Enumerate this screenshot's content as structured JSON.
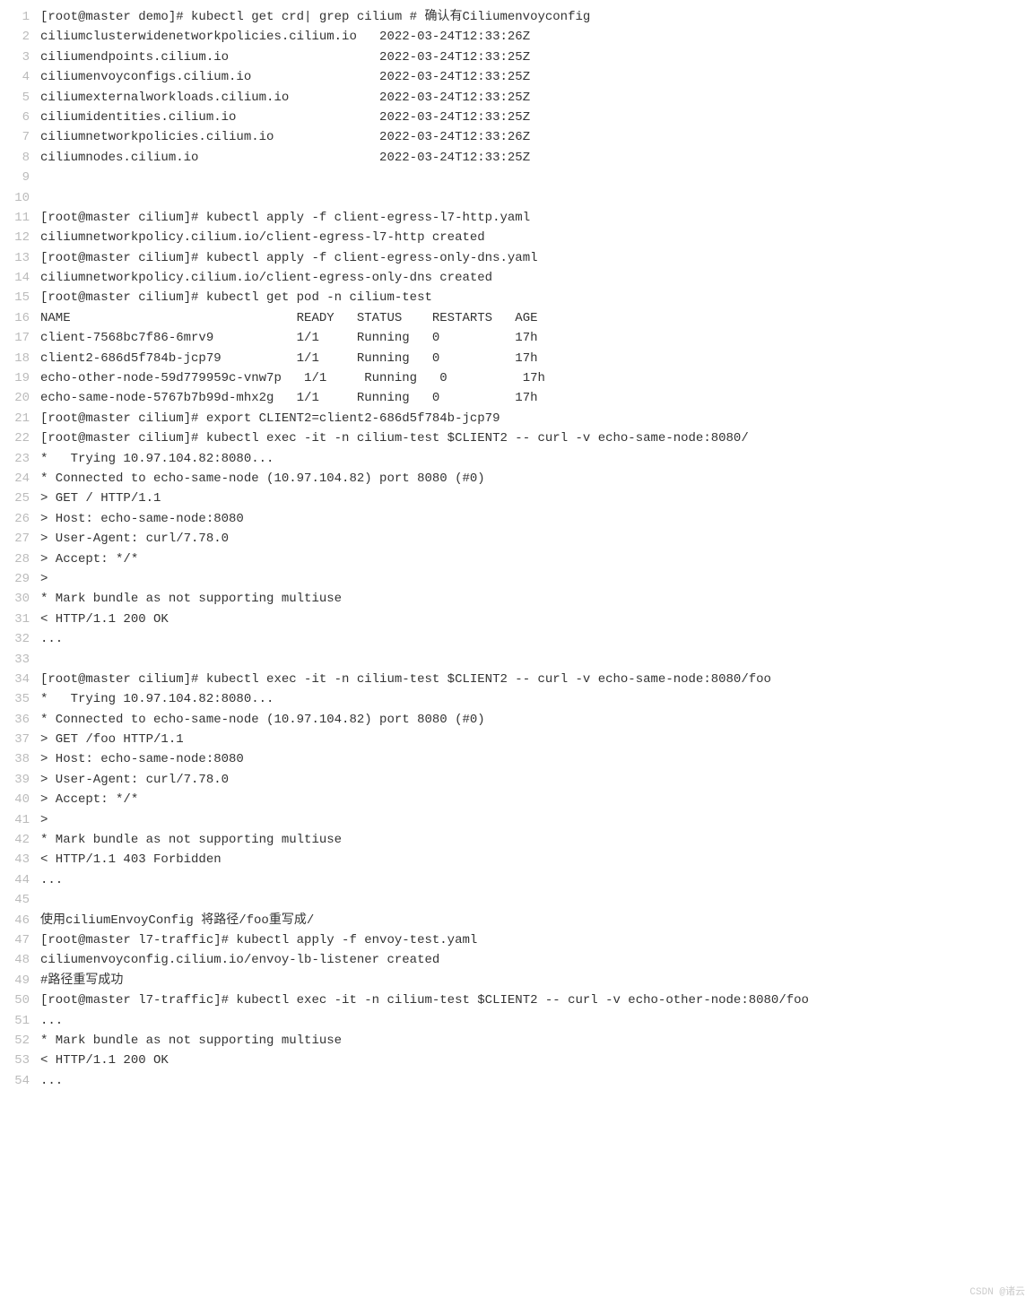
{
  "lines": [
    "[root@master demo]# kubectl get crd| grep cilium # 确认有Ciliumenvoyconfig",
    "ciliumclusterwidenetworkpolicies.cilium.io   2022-03-24T12:33:26Z",
    "ciliumendpoints.cilium.io                    2022-03-24T12:33:25Z",
    "ciliumenvoyconfigs.cilium.io                 2022-03-24T12:33:25Z",
    "ciliumexternalworkloads.cilium.io            2022-03-24T12:33:25Z",
    "ciliumidentities.cilium.io                   2022-03-24T12:33:25Z",
    "ciliumnetworkpolicies.cilium.io              2022-03-24T12:33:26Z",
    "ciliumnodes.cilium.io                        2022-03-24T12:33:25Z",
    "",
    "",
    "[root@master cilium]# kubectl apply -f client-egress-l7-http.yaml",
    "ciliumnetworkpolicy.cilium.io/client-egress-l7-http created",
    "[root@master cilium]# kubectl apply -f client-egress-only-dns.yaml",
    "ciliumnetworkpolicy.cilium.io/client-egress-only-dns created",
    "[root@master cilium]# kubectl get pod -n cilium-test",
    "NAME                              READY   STATUS    RESTARTS   AGE",
    "client-7568bc7f86-6mrv9           1/1     Running   0          17h",
    "client2-686d5f784b-jcp79          1/1     Running   0          17h",
    "echo-other-node-59d779959c-vnw7p   1/1     Running   0          17h",
    "echo-same-node-5767b7b99d-mhx2g   1/1     Running   0          17h",
    "[root@master cilium]# export CLIENT2=client2-686d5f784b-jcp79",
    "[root@master cilium]# kubectl exec -it -n cilium-test $CLIENT2 -- curl -v echo-same-node:8080/",
    "*   Trying 10.97.104.82:8080...",
    "* Connected to echo-same-node (10.97.104.82) port 8080 (#0)",
    "> GET / HTTP/1.1",
    "> Host: echo-same-node:8080",
    "> User-Agent: curl/7.78.0",
    "> Accept: */*",
    ">",
    "* Mark bundle as not supporting multiuse",
    "< HTTP/1.1 200 OK",
    "...",
    "",
    "[root@master cilium]# kubectl exec -it -n cilium-test $CLIENT2 -- curl -v echo-same-node:8080/foo",
    "*   Trying 10.97.104.82:8080...",
    "* Connected to echo-same-node (10.97.104.82) port 8080 (#0)",
    "> GET /foo HTTP/1.1",
    "> Host: echo-same-node:8080",
    "> User-Agent: curl/7.78.0",
    "> Accept: */*",
    ">",
    "* Mark bundle as not supporting multiuse",
    "< HTTP/1.1 403 Forbidden",
    "...",
    "",
    "使用ciliumEnvoyConfig 将路径/foo重写成/",
    "[root@master l7-traffic]# kubectl apply -f envoy-test.yaml",
    "ciliumenvoyconfig.cilium.io/envoy-lb-listener created",
    "#路径重写成功",
    "[root@master l7-traffic]# kubectl exec -it -n cilium-test $CLIENT2 -- curl -v echo-other-node:8080/foo",
    "...",
    "* Mark bundle as not supporting multiuse",
    "< HTTP/1.1 200 OK",
    "..."
  ],
  "watermark": "CSDN @诸云"
}
